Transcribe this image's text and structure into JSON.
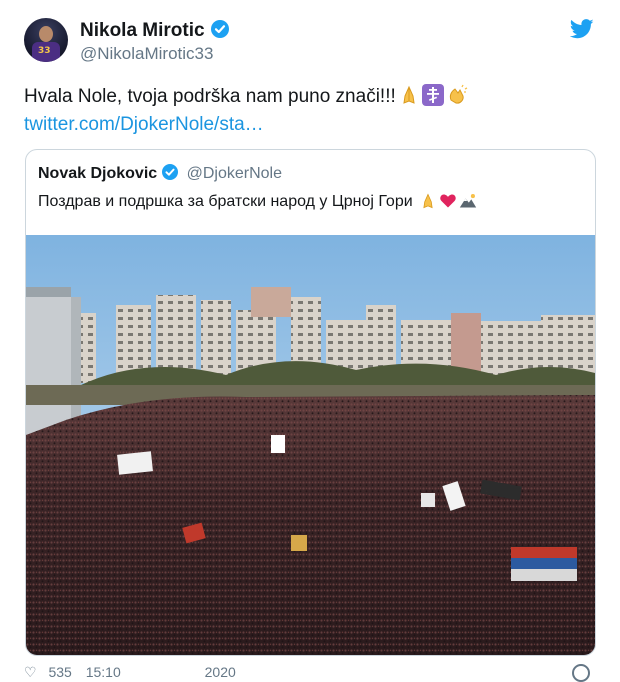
{
  "author": {
    "name": "Nikola Mirotic",
    "handle": "@NikolaMirotic33",
    "avatar_number": "33"
  },
  "tweet": {
    "text": "Hvala Nole, tvoja podrška nam puno znači!!!",
    "emojis": [
      "folded-hands",
      "orthodox-cross",
      "clapping-hands"
    ],
    "link": "twitter.com/DjokerNole/sta…"
  },
  "quoted": {
    "name": "Novak Djokovic",
    "handle": "@DjokerNole",
    "text": "Поздрав и подршка за братски народ у Црној Гори",
    "emojis": [
      "folded-hands",
      "red-heart",
      "mountain"
    ]
  },
  "footer": {
    "likes": "535",
    "time": "15:10",
    "date": "2020"
  },
  "colors": {
    "twitter_blue": "#1da1f2",
    "link_blue": "#1b95e0",
    "secondary_text": "#657786",
    "border": "#ccd6dd"
  }
}
